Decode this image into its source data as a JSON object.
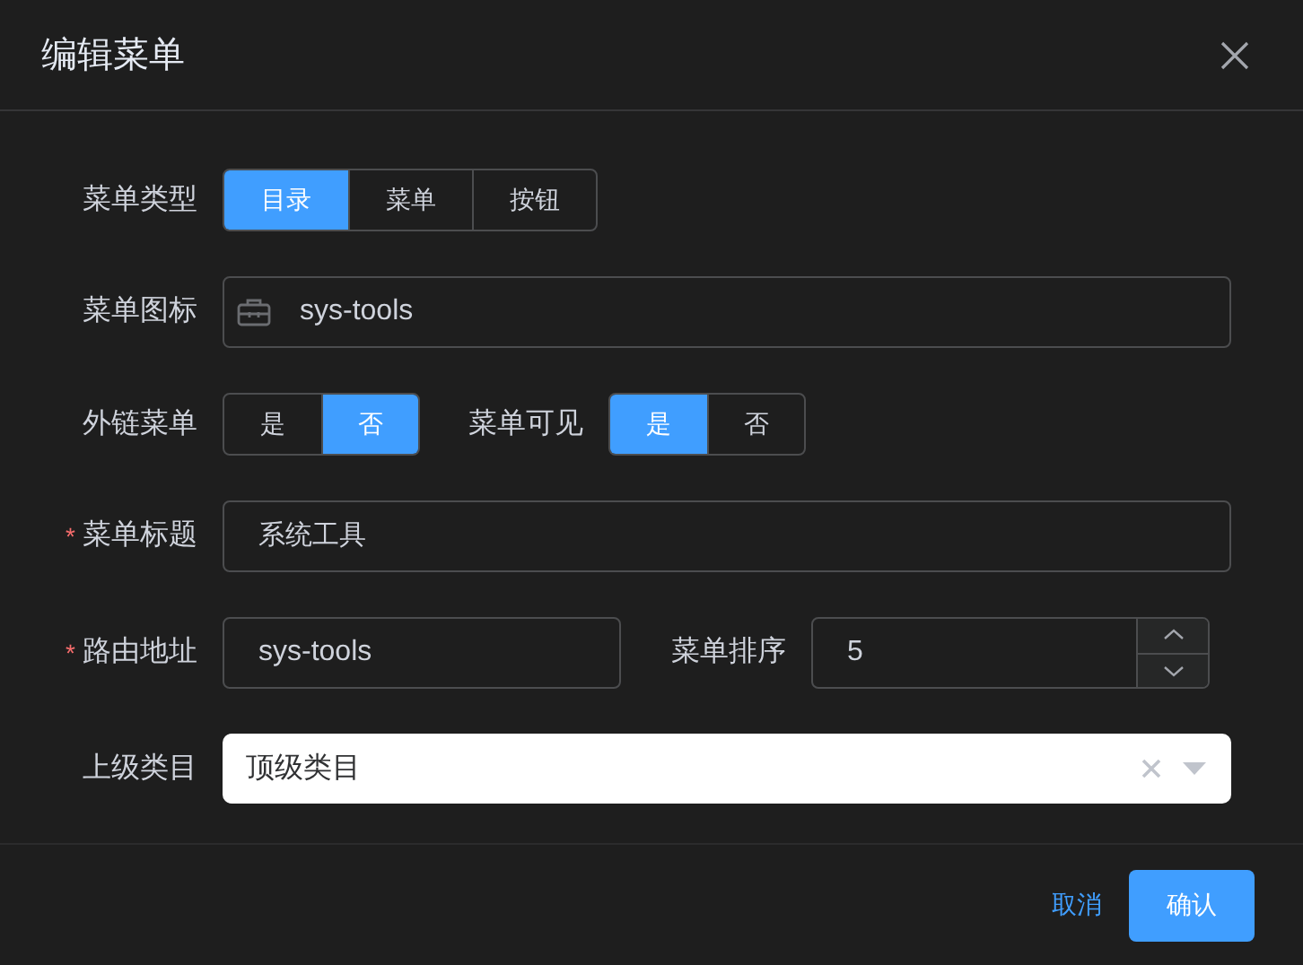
{
  "dialog": {
    "title": "编辑菜单"
  },
  "menu_type": {
    "label": "菜单类型",
    "options": [
      {
        "label": "目录",
        "selected": true
      },
      {
        "label": "菜单",
        "selected": false
      },
      {
        "label": "按钮",
        "selected": false
      }
    ]
  },
  "menu_icon": {
    "label": "菜单图标",
    "value": "sys-tools"
  },
  "external": {
    "label": "外链菜单",
    "options": [
      {
        "label": "是",
        "selected": false
      },
      {
        "label": "否",
        "selected": true
      }
    ]
  },
  "visible": {
    "label": "菜单可见",
    "options": [
      {
        "label": "是",
        "selected": true
      },
      {
        "label": "否",
        "selected": false
      }
    ]
  },
  "menu_title": {
    "label": "菜单标题",
    "required_mark": "*",
    "value": "系统工具"
  },
  "route": {
    "label": "路由地址",
    "required_mark": "*",
    "value": "sys-tools"
  },
  "sort": {
    "label": "菜单排序",
    "value": "5"
  },
  "parent": {
    "label": "上级类目",
    "value": "顶级类目"
  },
  "buttons": [
    {
      "label": "取消",
      "kind": "text"
    },
    {
      "label": "确认",
      "kind": "primary"
    }
  ]
}
